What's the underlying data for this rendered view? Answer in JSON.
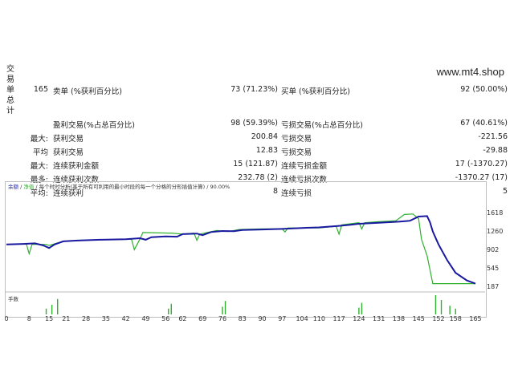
{
  "side_label": "交易单总计",
  "brand": "www.mt4.shop",
  "stats": {
    "total_trades": "165",
    "short_label": "卖单 (%获利百分比)",
    "short_value": "73 (71.23%)",
    "long_label": "买单 (%获利百分比)",
    "long_value": "92 (50.00%)",
    "profit_trades_label": "盈利交易(%占总百分比)",
    "profit_trades_value": "98 (59.39%)",
    "loss_trades_label": "亏损交易(%占总百分比)",
    "loss_trades_value": "67 (40.61%)",
    "largest_prefix": "最大:",
    "largest_profit_label": "获利交易",
    "largest_profit_value": "200.84",
    "largest_loss_label": "亏损交易",
    "largest_loss_value": "-221.56",
    "average_prefix": "平均",
    "average_profit_label": "获利交易",
    "average_profit_value": "12.83",
    "average_loss_label": "亏损交易",
    "average_loss_value": "-29.88",
    "maxcons_prefix": "最大:",
    "maxcons_wins_label": "连续获利金额",
    "maxcons_wins_value": "15 (121.87)",
    "maxcons_losses_label": "连续亏损金额",
    "maxcons_losses_value": "17 (-1370.27)",
    "maximal_prefix": "最多:",
    "maximal_profit_label": "连续获利次数",
    "maximal_profit_value": "232.78 (2)",
    "maximal_loss_label": "连续亏损次数",
    "maximal_loss_value": "-1370.27 (17)",
    "avgcons_prefix": "平均:",
    "avgcons_wins_label": "连续获利",
    "avgcons_wins_value": "8",
    "avgcons_losses_label": "连续亏损",
    "avgcons_losses_value": "5"
  },
  "chart": {
    "legend_balance": "余额",
    "legend_sep": " / ",
    "legend_equity": "净值",
    "legend_rest": " / 每个时时分析(基于所有可利用的最小时段的每一个分格的分形插值计算) / 90.00%",
    "volume_label": "手数",
    "colors": {
      "balance": "#1a1aa0",
      "equity": "#2fb02f",
      "volume": "#2fb02f"
    }
  },
  "chart_data": {
    "type": "line",
    "y_ticks": [
      "1618",
      "1260",
      "902",
      "545",
      "187"
    ],
    "ylim": [
      187,
      1618
    ],
    "x_ticks": [
      "0",
      "8",
      "15",
      "21",
      "28",
      "35",
      "42",
      "49",
      "56",
      "62",
      "69",
      "76",
      "83",
      "90",
      "97",
      "104",
      "110",
      "117",
      "124",
      "131",
      "138",
      "145",
      "152",
      "158",
      "165"
    ],
    "xlim": [
      0,
      165
    ],
    "series": [
      {
        "name": "余额",
        "points": [
          [
            0,
            1000
          ],
          [
            6,
            1010
          ],
          [
            10,
            1020
          ],
          [
            13,
            980
          ],
          [
            15,
            930
          ],
          [
            17,
            1000
          ],
          [
            20,
            1060
          ],
          [
            25,
            1075
          ],
          [
            33,
            1090
          ],
          [
            42,
            1100
          ],
          [
            47,
            1120
          ],
          [
            49,
            1090
          ],
          [
            51,
            1140
          ],
          [
            56,
            1155
          ],
          [
            60,
            1150
          ],
          [
            62,
            1200
          ],
          [
            67,
            1210
          ],
          [
            69,
            1180
          ],
          [
            72,
            1240
          ],
          [
            76,
            1260
          ],
          [
            80,
            1255
          ],
          [
            83,
            1280
          ],
          [
            90,
            1290
          ],
          [
            97,
            1300
          ],
          [
            104,
            1320
          ],
          [
            110,
            1330
          ],
          [
            117,
            1360
          ],
          [
            121,
            1380
          ],
          [
            124,
            1400
          ],
          [
            131,
            1420
          ],
          [
            138,
            1440
          ],
          [
            142,
            1460
          ],
          [
            145,
            1540
          ],
          [
            148,
            1550
          ],
          [
            149,
            1430
          ],
          [
            150,
            1250
          ],
          [
            152,
            1000
          ],
          [
            155,
            700
          ],
          [
            158,
            450
          ],
          [
            162,
            300
          ],
          [
            165,
            240
          ]
        ]
      },
      {
        "name": "净值",
        "points": [
          [
            0,
            1000
          ],
          [
            7,
            1010
          ],
          [
            8,
            820
          ],
          [
            9,
            1000
          ],
          [
            14,
            1000
          ],
          [
            15,
            980
          ],
          [
            20,
            1060
          ],
          [
            33,
            1090
          ],
          [
            44,
            1100
          ],
          [
            45,
            900
          ],
          [
            47,
            1110
          ],
          [
            48,
            1230
          ],
          [
            57,
            1220
          ],
          [
            58,
            1220
          ],
          [
            62,
            1200
          ],
          [
            66,
            1220
          ],
          [
            67,
            1080
          ],
          [
            68,
            1200
          ],
          [
            74,
            1270
          ],
          [
            78,
            1250
          ],
          [
            82,
            1290
          ],
          [
            90,
            1300
          ],
          [
            97,
            1300
          ],
          [
            98,
            1240
          ],
          [
            99,
            1320
          ],
          [
            110,
            1320
          ],
          [
            116,
            1350
          ],
          [
            117,
            1200
          ],
          [
            118,
            1380
          ],
          [
            124,
            1420
          ],
          [
            125,
            1300
          ],
          [
            126,
            1420
          ],
          [
            131,
            1440
          ],
          [
            137,
            1460
          ],
          [
            140,
            1580
          ],
          [
            143,
            1590
          ],
          [
            145,
            1500
          ],
          [
            146,
            1100
          ],
          [
            148,
            780
          ],
          [
            150,
            240
          ],
          [
            158,
            240
          ],
          [
            163,
            240
          ],
          [
            165,
            240
          ]
        ]
      }
    ],
    "volume_spikes": [
      [
        14,
        0.3
      ],
      [
        16,
        0.5
      ],
      [
        18,
        0.8
      ],
      [
        57,
        0.3
      ],
      [
        58,
        0.55
      ],
      [
        76,
        0.4
      ],
      [
        77,
        0.7
      ],
      [
        124,
        0.35
      ],
      [
        125,
        0.6
      ],
      [
        151,
        1.0
      ],
      [
        153,
        0.75
      ],
      [
        156,
        0.45
      ],
      [
        158,
        0.3
      ]
    ]
  }
}
